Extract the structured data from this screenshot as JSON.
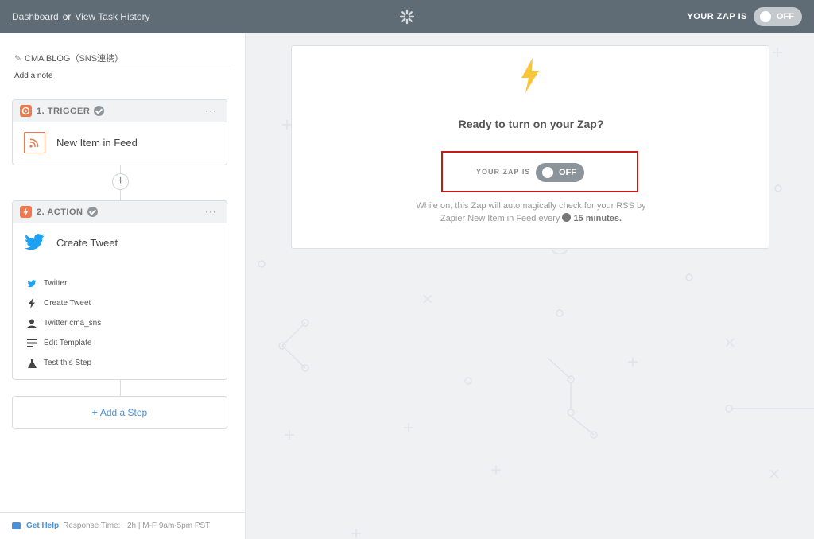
{
  "topbar": {
    "dashboard": "Dashboard",
    "or": "or",
    "history": "View Task History",
    "zap_is_label": "YOUR ZAP IS",
    "toggle_state": "OFF"
  },
  "sidebar": {
    "zap_name": "CMA BLOG（SNS連携）",
    "add_note": "Add a note",
    "trigger": {
      "step_label": "1. TRIGGER",
      "title": "New Item in Feed",
      "more": "···"
    },
    "action": {
      "step_label": "2. ACTION",
      "title": "Create Tweet",
      "more": "···",
      "substeps": [
        "Twitter",
        "Create Tweet",
        "Twitter cma_sns",
        "Edit Template",
        "Test this Step"
      ]
    },
    "add_step": "Add a Step",
    "help": {
      "link": "Get Help",
      "meta": "Response Time: ~2h | M-F 9am-5pm PST"
    }
  },
  "main": {
    "heading": "Ready to turn on your Zap?",
    "zap_is_label": "YOUR ZAP IS",
    "toggle_state": "OFF",
    "desc_line1": "While on, this Zap will automagically check for your RSS by",
    "desc_line2_pre": "Zapier New Item in Feed every",
    "desc_interval": "15 minutes."
  },
  "colors": {
    "topbar": "#5f6b75",
    "accent_blue": "#4a90d9",
    "rss_orange": "#f0784a",
    "bolt_yellow": "#f8c63a",
    "highlight_red": "#c41a1a",
    "twitter_blue": "#1da1f2"
  }
}
